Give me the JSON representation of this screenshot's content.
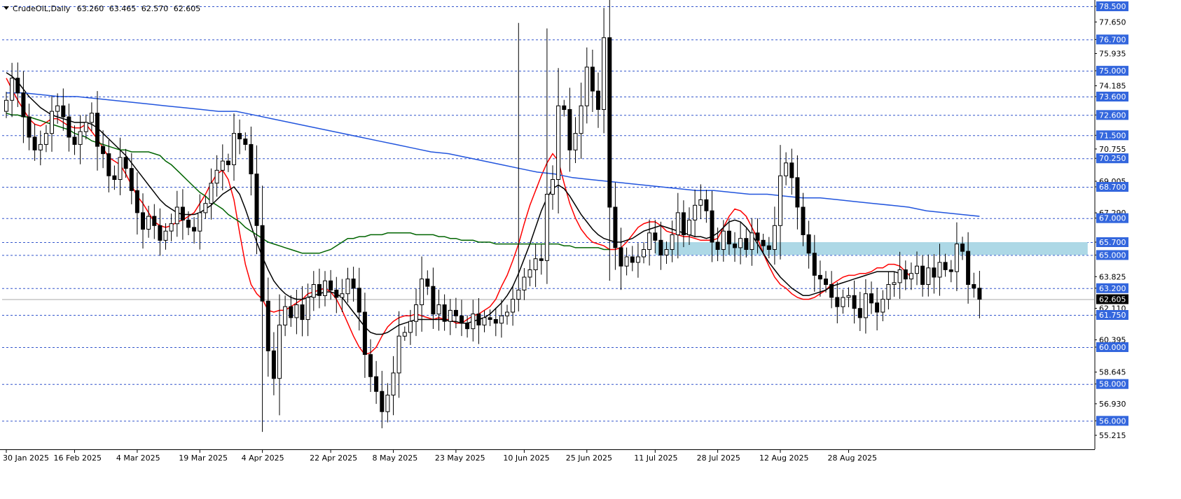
{
  "header": {
    "symbol": "CrudeOIL,Daily",
    "open": "63.260",
    "high": "63.465",
    "low": "62.570",
    "close": "62.605"
  },
  "chart_data": {
    "type": "candlestick",
    "title": "",
    "xlabel": "",
    "ylabel": "",
    "ylim": [
      55.0,
      78.7
    ],
    "grid": false,
    "price_axis_labels": [
      "78.500",
      "77.650",
      "76.700",
      "75.935",
      "75.000",
      "74.185",
      "73.600",
      "72.600",
      "71.500",
      "70.755",
      "70.250",
      "69.005",
      "68.700",
      "67.290",
      "67.000",
      "65.700",
      "65.000",
      "63.825",
      "63.200",
      "62.110",
      "61.750",
      "60.395",
      "60.000",
      "58.645",
      "58.000",
      "56.930",
      "56.000",
      "55.215"
    ],
    "horizontal_levels": [
      {
        "label": "78.500",
        "value": 78.5,
        "boxed": true
      },
      {
        "label": "76.700",
        "value": 76.7,
        "boxed": true
      },
      {
        "label": "75.000",
        "value": 75.0,
        "boxed": true
      },
      {
        "label": "73.600",
        "value": 73.6,
        "boxed": true
      },
      {
        "label": "72.600",
        "value": 72.6,
        "boxed": true
      },
      {
        "label": "71.500",
        "value": 71.5,
        "boxed": true
      },
      {
        "label": "70.250",
        "value": 70.25,
        "boxed": true
      },
      {
        "label": "68.700",
        "value": 68.7,
        "boxed": true
      },
      {
        "label": "67.000",
        "value": 67.0,
        "boxed": true
      },
      {
        "label": "65.700",
        "value": 65.7,
        "boxed": true
      },
      {
        "label": "65.000",
        "value": 65.0,
        "boxed": true
      },
      {
        "label": "63.200",
        "value": 63.2,
        "boxed": true
      },
      {
        "label": "61.750",
        "value": 61.75,
        "boxed": true
      },
      {
        "label": "60.000",
        "value": 60.0,
        "boxed": true
      },
      {
        "label": "58.000",
        "value": 58.0,
        "boxed": true
      },
      {
        "label": "56.000",
        "value": 56.0,
        "boxed": true
      }
    ],
    "current_price": {
      "label": "62.605",
      "value": 62.605
    },
    "zone": {
      "from": 65.0,
      "to": 65.7,
      "start_index": 114,
      "end_index": 190,
      "color": "#add8e6"
    },
    "date_labels": [
      {
        "label": "30 Jan 2025",
        "index": 0
      },
      {
        "label": "16 Feb 2025",
        "index": 12
      },
      {
        "label": "4 Mar 2025",
        "index": 23
      },
      {
        "label": "19 Mar 2025",
        "index": 34
      },
      {
        "label": "4 Apr 2025",
        "index": 45
      },
      {
        "label": "22 Apr 2025",
        "index": 57
      },
      {
        "label": "8 May 2025",
        "index": 68
      },
      {
        "label": "23 May 2025",
        "index": 79
      },
      {
        "label": "10 Jun 2025",
        "index": 91
      },
      {
        "label": "25 Jun 2025",
        "index": 102
      },
      {
        "label": "11 Jul 2025",
        "index": 114
      },
      {
        "label": "28 Jul 2025",
        "index": 125
      },
      {
        "label": "12 Aug 2025",
        "index": 136
      },
      {
        "label": "28 Aug 2025",
        "index": 148
      }
    ],
    "closes": [
      73.4,
      74.6,
      73.8,
      72.5,
      71.4,
      70.7,
      71.0,
      71.6,
      72.8,
      73.1,
      72.5,
      71.4,
      71.0,
      71.7,
      72.2,
      72.7,
      70.9,
      70.5,
      69.3,
      69.1,
      70.3,
      69.7,
      68.5,
      67.3,
      66.4,
      67.1,
      66.6,
      65.8,
      66.3,
      66.7,
      67.6,
      66.9,
      66.5,
      66.3,
      67.3,
      67.8,
      68.9,
      69.6,
      70.1,
      69.9,
      71.6,
      71.3,
      71.0,
      69.4,
      66.6,
      62.5,
      59.8,
      58.3,
      61.2,
      62.2,
      61.6,
      62.3,
      61.5,
      62.7,
      63.4,
      62.8,
      63.6,
      63.1,
      62.7,
      62.9,
      63.7,
      63.2,
      61.9,
      59.6,
      58.4,
      57.6,
      56.5,
      57.4,
      58.6,
      60.6,
      60.8,
      61.4,
      62.3,
      63.7,
      63.3,
      61.8,
      62.3,
      61.4,
      62.0,
      61.7,
      61.3,
      61.0,
      61.8,
      61.2,
      61.6,
      61.5,
      61.3,
      61.7,
      61.9,
      62.6,
      63.1,
      63.8,
      64.2,
      64.8,
      64.7,
      68.3,
      69.1,
      73.1,
      72.9,
      70.7,
      71.6,
      73.1,
      75.2,
      73.9,
      72.9,
      76.8,
      67.6,
      65.4,
      64.4,
      64.9,
      64.6,
      64.9,
      65.3,
      66.2,
      65.8,
      65.0,
      65.3,
      66.1,
      67.3,
      66.1,
      66.9,
      67.7,
      68.0,
      67.4,
      65.7,
      65.3,
      66.3,
      65.6,
      65.4,
      65.9,
      65.3,
      66.2,
      65.8,
      65.5,
      65.3,
      66.6,
      69.3,
      70.0,
      69.2,
      67.6,
      66.1,
      65.1,
      63.9,
      63.7,
      63.4,
      62.7,
      62.2,
      62.7,
      62.8,
      62.1,
      61.6,
      62.9,
      62.4,
      61.9,
      62.6,
      63.4,
      63.5,
      64.2,
      63.7,
      64.0,
      64.4,
      63.4,
      64.3,
      63.8,
      64.6,
      64.2,
      64.1,
      65.6,
      65.2,
      63.4,
      63.2,
      62.6
    ],
    "series": [
      {
        "name": "",
        "color": "#ff0000",
        "start_index": 0,
        "values": [
          74.6,
          74.0,
          73.4,
          72.9,
          72.4,
          72.1,
          72.0,
          72.2,
          72.4,
          72.4,
          72.2,
          72.0,
          71.9,
          71.9,
          72.1,
          71.7,
          71.3,
          70.8,
          70.3,
          70.1,
          69.9,
          69.4,
          68.8,
          68.2,
          67.8,
          67.3,
          66.8,
          66.6,
          66.5,
          66.6,
          66.8,
          66.9,
          67.1,
          67.3,
          67.8,
          68.3,
          68.9,
          69.4,
          69.6,
          69.1,
          68.0,
          66.2,
          64.5,
          63.4,
          62.9,
          62.6,
          62.0,
          61.9,
          62.0,
          62.0,
          62.2,
          62.4,
          62.6,
          62.9,
          63.0,
          63.1,
          63.2,
          63.0,
          62.6,
          62.0,
          61.3,
          60.6,
          60.0,
          59.6,
          59.7,
          60.0,
          60.6,
          61.1,
          61.4,
          61.6,
          61.7,
          61.7,
          61.8,
          61.7,
          61.6,
          61.5,
          61.6,
          61.5,
          61.5,
          61.3,
          61.3,
          61.5,
          61.7,
          61.8,
          62.0,
          62.2,
          62.6,
          63.3,
          63.9,
          64.7,
          65.6,
          66.7,
          67.7,
          68.5,
          69.3,
          70.0,
          70.5,
          70.1,
          68.9,
          67.8,
          67.0,
          66.4,
          66.0,
          65.7,
          65.6,
          65.5,
          65.3,
          65.3,
          65.4,
          65.7,
          66.1,
          66.5,
          66.7,
          66.8,
          66.8,
          66.6,
          66.3,
          66.2,
          66.1,
          66.0,
          66.0,
          65.9,
          65.8,
          65.8,
          65.8,
          65.9,
          66.5,
          67.1,
          67.5,
          67.4,
          67.1,
          66.5,
          65.9,
          65.1,
          64.4,
          63.8,
          63.4,
          63.2,
          62.9,
          62.7,
          62.6,
          62.6,
          62.7,
          62.9,
          63.1,
          63.4,
          63.6,
          63.8,
          63.9,
          63.9,
          64.0,
          64.0,
          64.1,
          64.3,
          64.3,
          64.5,
          64.5,
          64.4,
          64.1,
          63.8
        ]
      },
      {
        "name": "",
        "color": "#000000",
        "start_index": 0,
        "values": [
          74.9,
          74.7,
          74.4,
          74.0,
          73.6,
          73.3,
          73.0,
          72.8,
          72.6,
          72.5,
          72.4,
          72.3,
          72.2,
          72.2,
          72.2,
          72.1,
          71.9,
          71.6,
          71.3,
          71.0,
          70.7,
          70.4,
          70.0,
          69.6,
          69.2,
          68.8,
          68.4,
          68.0,
          67.7,
          67.5,
          67.3,
          67.2,
          67.2,
          67.2,
          67.3,
          67.5,
          67.7,
          68.0,
          68.3,
          68.5,
          68.7,
          68.3,
          67.5,
          66.6,
          65.7,
          64.9,
          64.2,
          63.6,
          63.2,
          62.9,
          62.7,
          62.6,
          62.6,
          62.7,
          62.8,
          62.9,
          63.0,
          63.0,
          62.9,
          62.7,
          62.3,
          61.9,
          61.5,
          61.1,
          60.8,
          60.7,
          60.7,
          60.8,
          61.0,
          61.2,
          61.3,
          61.4,
          61.5,
          61.5,
          61.5,
          61.5,
          61.5,
          61.5,
          61.4,
          61.4,
          61.3,
          61.3,
          61.4,
          61.5,
          61.6,
          61.8,
          62.1,
          62.4,
          62.8,
          63.3,
          64.0,
          64.8,
          65.6,
          66.5,
          67.4,
          68.1,
          68.6,
          68.8,
          68.6,
          68.2,
          67.7,
          67.2,
          66.8,
          66.4,
          66.1,
          65.9,
          65.8,
          65.7,
          65.7,
          65.8,
          65.9,
          66.1,
          66.3,
          66.4,
          66.5,
          66.6,
          66.5,
          66.4,
          66.3,
          66.2,
          66.1,
          66.0,
          66.0,
          65.9,
          66.0,
          66.2,
          66.5,
          66.8,
          66.9,
          66.8,
          66.5,
          66.1,
          65.6,
          65.1,
          64.6,
          64.2,
          63.8,
          63.5,
          63.2,
          63.0,
          62.8,
          62.8,
          62.9,
          63.0,
          63.1,
          63.3,
          63.4,
          63.5,
          63.6,
          63.7,
          63.8,
          63.9,
          64.0,
          64.1,
          64.1,
          64.1,
          64.1,
          64.0
        ]
      },
      {
        "name": "",
        "color": "#006400",
        "start_index": 0,
        "values": [
          72.7,
          72.6,
          72.6,
          72.5,
          72.5,
          72.4,
          72.3,
          72.2,
          72.1,
          72.0,
          71.9,
          71.8,
          71.6,
          71.5,
          71.4,
          71.2,
          71.1,
          71.0,
          70.9,
          70.8,
          70.7,
          70.7,
          70.6,
          70.6,
          70.6,
          70.6,
          70.5,
          70.4,
          70.1,
          69.9,
          69.6,
          69.3,
          69.0,
          68.7,
          68.4,
          68.2,
          67.9,
          67.7,
          67.5,
          67.2,
          67.0,
          66.8,
          66.5,
          66.3,
          66.1,
          65.9,
          65.7,
          65.6,
          65.5,
          65.4,
          65.3,
          65.2,
          65.1,
          65.1,
          65.1,
          65.1,
          65.2,
          65.3,
          65.5,
          65.7,
          65.9,
          65.9,
          66.0,
          66.0,
          66.1,
          66.1,
          66.1,
          66.2,
          66.2,
          66.2,
          66.2,
          66.2,
          66.1,
          66.1,
          66.1,
          66.1,
          66.0,
          66.0,
          65.9,
          65.9,
          65.8,
          65.8,
          65.8,
          65.7,
          65.7,
          65.7,
          65.6,
          65.6,
          65.6,
          65.6,
          65.6,
          65.6,
          65.6,
          65.6,
          65.6,
          65.6,
          65.6,
          65.6,
          65.5,
          65.5,
          65.4,
          65.4,
          65.4,
          65.4,
          65.4,
          65.3,
          65.3
        ]
      },
      {
        "name": "",
        "color": "#2255dd",
        "start_index": 0,
        "values": [
          73.8,
          73.8,
          73.7,
          73.6,
          73.6,
          73.5,
          73.4,
          73.3,
          73.2,
          73.1,
          73.0,
          72.9,
          72.8,
          72.8,
          72.6,
          72.4,
          72.2,
          72.0,
          71.8,
          71.6,
          71.4,
          71.2,
          71.0,
          70.8,
          70.6,
          70.5,
          70.3,
          70.1,
          69.9,
          69.7,
          69.5,
          69.4,
          69.2,
          69.1,
          69.0,
          68.9,
          68.8,
          68.7,
          68.6,
          68.5,
          68.5,
          68.4,
          68.3,
          68.3,
          68.2,
          68.1,
          68.1,
          68.0,
          67.9,
          67.8,
          67.7,
          67.6,
          67.4,
          67.3,
          67.2,
          67.1
        ]
      }
    ]
  }
}
